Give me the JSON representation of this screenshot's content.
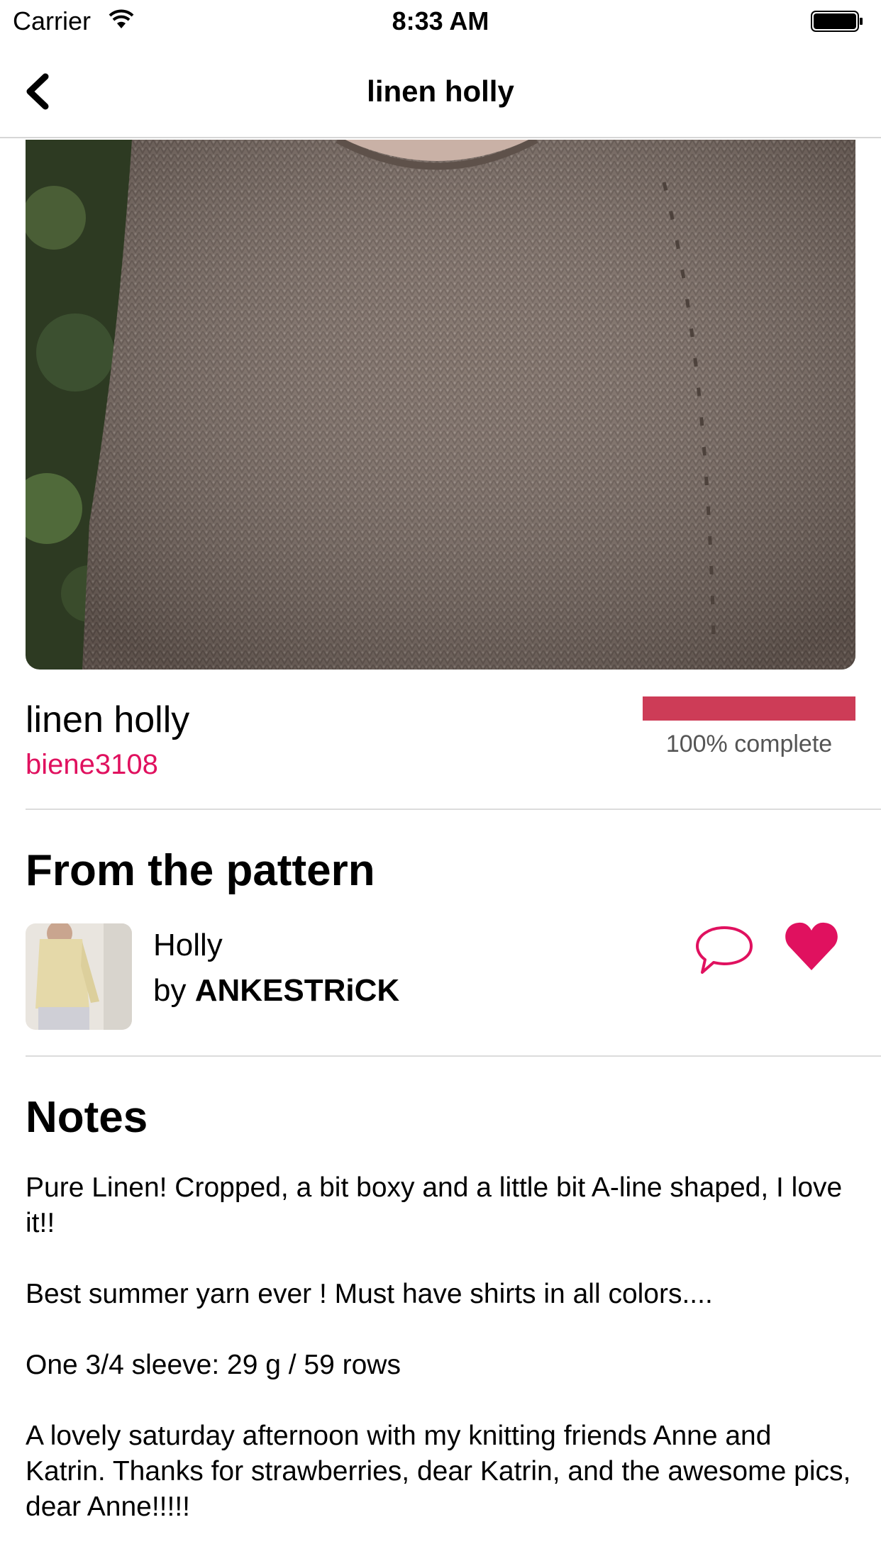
{
  "status_bar": {
    "carrier": "Carrier",
    "time": "8:33 AM"
  },
  "nav": {
    "title": "linen holly",
    "back_icon": "chevron-left-icon"
  },
  "project": {
    "name": "linen holly",
    "user": "biene3108",
    "progress_percent": 100,
    "progress_text": "100% complete",
    "progress_color": "#cd3c57",
    "user_color": "#e0115f"
  },
  "pattern_section": {
    "title": "From the pattern",
    "pattern_name": "Holly",
    "by_prefix": "by",
    "designer": "ANKESTRiCK",
    "comment_icon": "speech-bubble-icon",
    "favorite_icon": "heart-icon",
    "accent_color": "#e0115f"
  },
  "notes_section": {
    "title": "Notes",
    "paragraphs": [
      "Pure Linen! Cropped, a bit boxy and a little bit A-line shaped, I love it!!",
      "Best summer yarn ever ! Must have shirts in all colors....",
      "One 3/4 sleeve: 29 g / 59 rows",
      "A lovely saturday afternoon with my knitting friends Anne and Katrin. Thanks for strawberries, dear Katrin, and the awesome pics, dear Anne!!!!!"
    ]
  }
}
